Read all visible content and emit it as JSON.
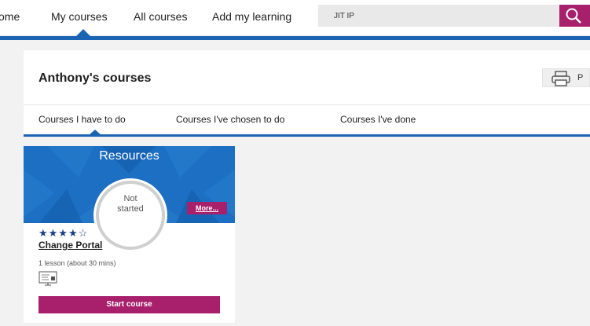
{
  "nav": {
    "items": [
      "ome",
      "My courses",
      "All courses",
      "Add my learning"
    ],
    "active": "My courses",
    "search_value": "JIT IP"
  },
  "panel": {
    "title": "Anthony's courses",
    "print_label": "P",
    "tabs": [
      "Courses I have to do",
      "Courses I've chosen to do",
      "Courses I've done"
    ],
    "active_tab": "Courses I have to do"
  },
  "card": {
    "banner_title": "Resources",
    "status_line1": "Not",
    "status_line2": "started",
    "more_label": "More...",
    "stars": "★★★★☆",
    "rating": 4,
    "rating_max": 5,
    "course_title": "Change Portal",
    "lessons": "1 lesson (about 30 mins)",
    "type_icon": "elearning-icon",
    "start_label": "Start course"
  },
  "colors": {
    "brand_blue": "#1b63b3",
    "accent_magenta": "#a81f6c",
    "banner_blue": "#1c6fc2"
  }
}
